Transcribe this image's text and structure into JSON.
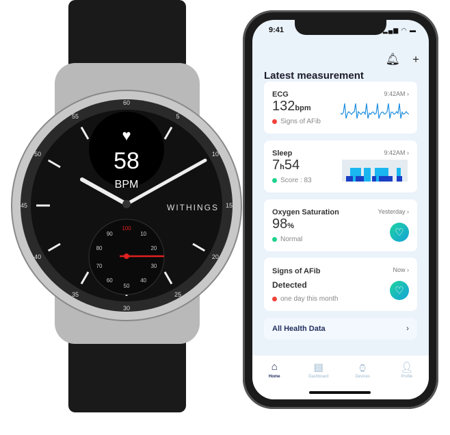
{
  "watch": {
    "brand": "WITHINGS",
    "heart_rate": "58",
    "heart_rate_unit": "BPM",
    "dial_numbers": [
      "60",
      "5",
      "10",
      "15",
      "20",
      "25",
      "30",
      "35",
      "40",
      "45",
      "50",
      "55"
    ],
    "subdial_numbers": [
      "100",
      "10",
      "20",
      "30",
      "40",
      "50",
      "60",
      "70",
      "80",
      "90"
    ]
  },
  "phone": {
    "status_time": "9:41",
    "status_icons": "▂▄▆ ◠ ▬",
    "header_icons": {
      "bell": "🔔︎",
      "add": "+"
    },
    "title": "Latest measurement",
    "cards": [
      {
        "label": "ECG",
        "time": "9:42AM ›",
        "value": "132",
        "unit": "bpm",
        "sub": "Signs of AFib",
        "dot_color": "#f0423a"
      },
      {
        "label": "Sleep",
        "time": "9:42AM ›",
        "value": "7",
        "unit": "h",
        "value2": "54",
        "sub": "Score : 83",
        "dot_color": "#1ed28c"
      },
      {
        "label": "Oxygen Saturation",
        "time": "Yesterday ›",
        "value": "98",
        "unit": "%",
        "sub": "Normal",
        "dot_color": "#1ed28c"
      },
      {
        "label": "Signs of AFib",
        "time": "Now ›",
        "value": "Detected",
        "sub": "one day this month",
        "dot_color": "#f0423a"
      }
    ],
    "all_health": "All Health Data",
    "chevron": "›",
    "heart_icon": "♡",
    "tabs": [
      {
        "label": "Home",
        "icon": "⌂",
        "active": true
      },
      {
        "label": "Dashboard",
        "icon": "▤"
      },
      {
        "label": "Devices",
        "icon": "⌚︎"
      },
      {
        "label": "Profile",
        "icon": "👤︎"
      }
    ],
    "accent": "#1e2a5a"
  }
}
